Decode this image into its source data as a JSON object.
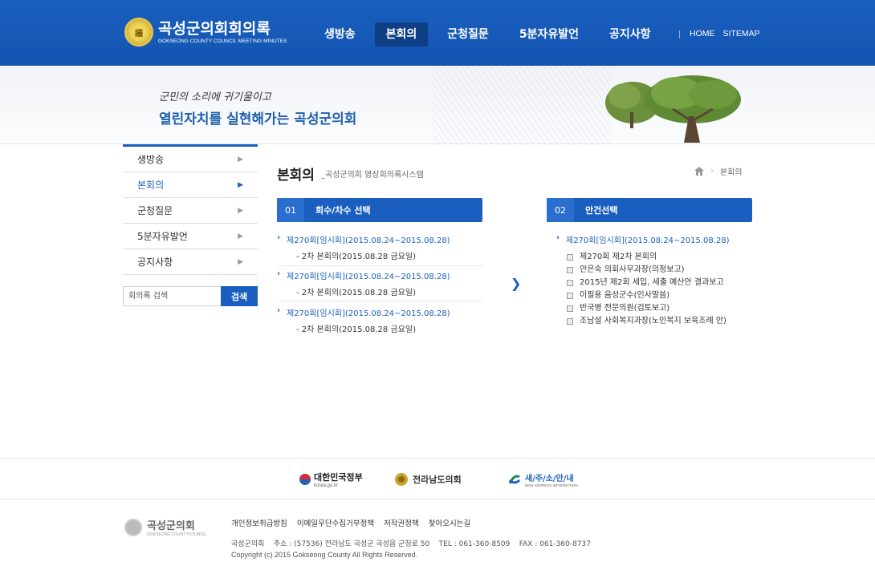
{
  "header": {
    "logo_title": "곡성군의회회의록",
    "logo_sub": "GOKSEONG COUNTY COUNCIL MEETING MINUTES",
    "nav": [
      {
        "label": "생방송",
        "active": false
      },
      {
        "label": "본회의",
        "active": true
      },
      {
        "label": "군청질문",
        "active": false
      },
      {
        "label": "5분자유발언",
        "active": false
      },
      {
        "label": "공지사항",
        "active": false
      }
    ],
    "util": {
      "home": "HOME",
      "sitemap": "SITEMAP"
    }
  },
  "visual": {
    "slogan_small": "군민의 소리에 귀기울이고",
    "slogan_big": "열린자치를 실현해가는 곡성군의회"
  },
  "lnb": {
    "items": [
      {
        "label": "생방송",
        "active": false
      },
      {
        "label": "본회의",
        "active": true
      },
      {
        "label": "군청질문",
        "active": false
      },
      {
        "label": "5분자유발언",
        "active": false
      },
      {
        "label": "공지사항",
        "active": false
      }
    ],
    "search_placeholder": "회의록 검색",
    "search_button": "검색"
  },
  "content": {
    "title": "본회의",
    "subtitle": "_곡성군의회 영상회의록시스템",
    "breadcrumb": "본회의",
    "panel1": {
      "num": "01",
      "label": "회수/차수 선택"
    },
    "panel2": {
      "num": "02",
      "label": "안건선택"
    },
    "sessions": [
      {
        "title": "제270회[임시회](2015.08.24~2015.08.28)",
        "detail": "- 2차 본회의(2015.08.28 금요일)"
      },
      {
        "title": "제270회[임시회](2015.08.24~2015.08.28)",
        "detail": "- 2차 본회의(2015.08.28 금요일)"
      },
      {
        "title": "제270회[임시회](2015.08.24~2015.08.28)",
        "detail": "- 2차 본회의(2015.08.28 금요일)"
      }
    ],
    "agenda_title": "제270회[임시회](2015.08.24~2015.08.28)",
    "agenda": [
      "제270회 제2차 본회의",
      "안은숙 의회사무과장(의정보고)",
      "2015년 제2회 세입, 세출 예산안 결과보고",
      "이필용 음성군수(인사말씀)",
      "반국병 전문의원(검토보고)",
      "조남설 사회복지과장(노인복지 보육조례 안)"
    ]
  },
  "footer": {
    "banners": [
      {
        "label": "대한민국정부",
        "sub": "korea.go.kr"
      },
      {
        "label": "전라남도의회",
        "sub": ""
      },
      {
        "label": "새/주/소/안/내",
        "sub": "NEW ADDRESS INFORMATION"
      }
    ],
    "logo_title": "곡성군의회",
    "logo_sub": "GOKSEONG COUNTYCOUNCIL",
    "links": [
      "개인정보취급방침",
      "이메일무단수집거부정책",
      "저작권정책",
      "찾아오시는길"
    ],
    "address": "곡성군의회    주소 : (57536) 전라남도 곡성군 곡성읍 군청로 50    TEL : 061-360-8509    FAX : 061-360-8737",
    "copyright": "Copyright (c) 2015 Gokseong County All Rights Reserved."
  }
}
